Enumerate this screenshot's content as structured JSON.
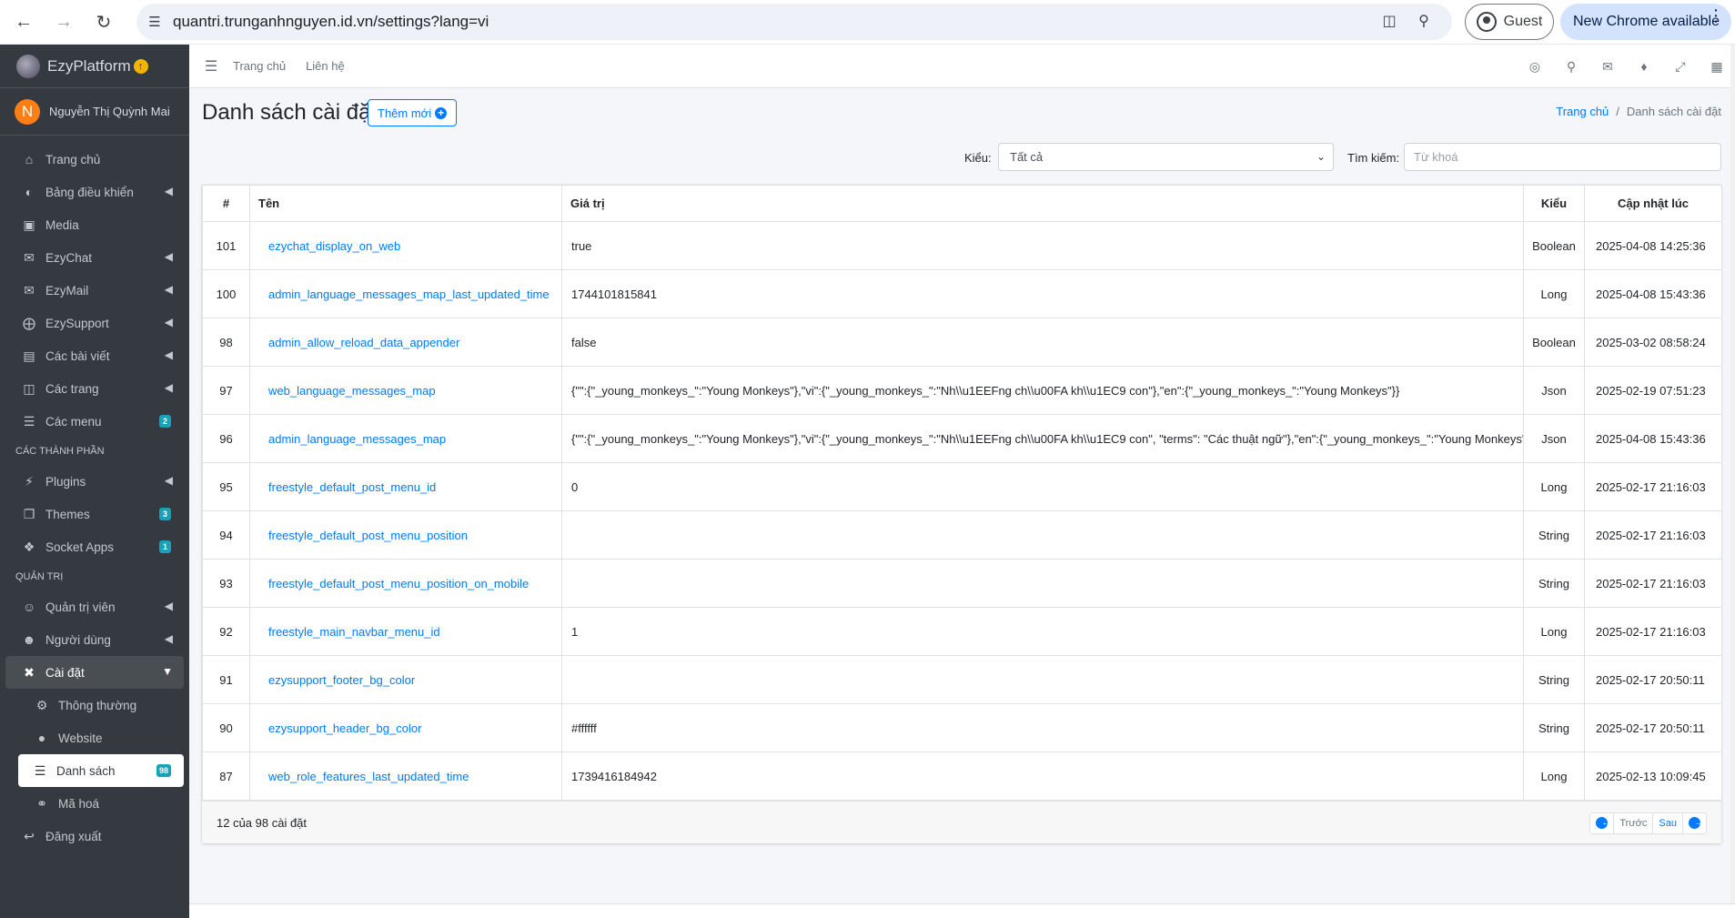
{
  "browser": {
    "url": "quantri.trunganhnguyen.id.vn/settings?lang=vi",
    "guest_label": "Guest",
    "update_label": "New Chrome available"
  },
  "sidebar": {
    "brand": "EzyPlatform",
    "user_initial": "N",
    "user_name": "Nguyễn Thị Quỳnh Mai",
    "items": [
      {
        "label": "Trang chủ",
        "icon": "home-icon"
      },
      {
        "label": "Bảng điều khiển",
        "icon": "dashboard-icon"
      },
      {
        "label": "Media",
        "icon": "image-icon"
      },
      {
        "label": "EzyChat",
        "icon": "chat-icon"
      },
      {
        "label": "EzyMail",
        "icon": "mail-icon"
      },
      {
        "label": "EzySupport",
        "icon": "lifebuoy-icon"
      },
      {
        "label": "Các bài viết",
        "icon": "newspaper-icon"
      },
      {
        "label": "Các trang",
        "icon": "columns-icon"
      },
      {
        "label": "Các menu",
        "icon": "menu-icon",
        "badge": "2"
      }
    ],
    "header_components": "CÁC THÀNH PHẦN",
    "components": [
      {
        "label": "Plugins",
        "icon": "plug-icon"
      },
      {
        "label": "Themes",
        "icon": "copy-icon",
        "badge": "3"
      },
      {
        "label": "Socket Apps",
        "icon": "cubes-icon",
        "badge": "1"
      }
    ],
    "header_admin": "QUẢN TRỊ",
    "admin": [
      {
        "label": "Quản trị viên",
        "icon": "user-circle-icon"
      },
      {
        "label": "Người dùng",
        "icon": "users-icon"
      },
      {
        "label": "Cài đặt",
        "icon": "tools-icon"
      }
    ],
    "settings_sub": [
      {
        "label": "Thông thường",
        "icon": "cogs-icon"
      },
      {
        "label": "Website",
        "icon": "globe-icon"
      },
      {
        "label": "Danh sách",
        "icon": "list-icon",
        "badge": "98"
      },
      {
        "label": "Mã hoá",
        "icon": "key-icon"
      }
    ],
    "logout": "Đăng xuất"
  },
  "topnav": {
    "home": "Trang chủ",
    "contact": "Liên hệ"
  },
  "page": {
    "title": "Danh sách cài đặt",
    "add_button": "Thêm mới",
    "breadcrumb_home": "Trang chủ",
    "breadcrumb_current": "Danh sách cài đặt"
  },
  "filters": {
    "type_label": "Kiểu:",
    "type_value": "Tất cả",
    "search_label": "Tìm kiếm:",
    "search_placeholder": "Từ khoá"
  },
  "table": {
    "headers": [
      "#",
      "Tên",
      "Giá trị",
      "Kiểu",
      "Cập nhật lúc"
    ],
    "rows": [
      {
        "id": "101",
        "name": "ezychat_display_on_web",
        "value": "true",
        "type": "Boolean",
        "updated": "2025-04-08 14:25:36"
      },
      {
        "id": "100",
        "name": "admin_language_messages_map_last_updated_time",
        "value": "1744101815841",
        "type": "Long",
        "updated": "2025-04-08 15:43:36"
      },
      {
        "id": "98",
        "name": "admin_allow_reload_data_appender",
        "value": "false",
        "type": "Boolean",
        "updated": "2025-03-02 08:58:24"
      },
      {
        "id": "97",
        "name": "web_language_messages_map",
        "value": "{\"\":{\"_young_monkeys_\":\"Young Monkeys\"},\"vi\":{\"_young_monkeys_\":\"Nh\\\\u1EEFng ch\\\\u00FA kh\\\\u1EC9 con\"},\"en\":{\"_young_monkeys_\":\"Young Monkeys\"}}",
        "type": "Json",
        "updated": "2025-02-19 07:51:23"
      },
      {
        "id": "96",
        "name": "admin_language_messages_map",
        "value": "{\"\":{\"_young_monkeys_\":\"Young Monkeys\"},\"vi\":{\"_young_monkeys_\":\"Nh\\\\u1EEFng ch\\\\u00FA kh\\\\u1EC9 con\", \"terms\": \"Các thuật ngữ\"},\"en\":{\"_young_monkeys_\":\"Young Monkeys\"}}",
        "type": "Json",
        "updated": "2025-04-08 15:43:36"
      },
      {
        "id": "95",
        "name": "freestyle_default_post_menu_id",
        "value": "0",
        "type": "Long",
        "updated": "2025-02-17 21:16:03"
      },
      {
        "id": "94",
        "name": "freestyle_default_post_menu_position",
        "value": "",
        "type": "String",
        "updated": "2025-02-17 21:16:03"
      },
      {
        "id": "93",
        "name": "freestyle_default_post_menu_position_on_mobile",
        "value": "",
        "type": "String",
        "updated": "2025-02-17 21:16:03"
      },
      {
        "id": "92",
        "name": "freestyle_main_navbar_menu_id",
        "value": "1",
        "type": "Long",
        "updated": "2025-02-17 21:16:03"
      },
      {
        "id": "91",
        "name": "ezysupport_footer_bg_color",
        "value": "",
        "type": "String",
        "updated": "2025-02-17 20:50:11"
      },
      {
        "id": "90",
        "name": "ezysupport_header_bg_color",
        "value": "#ffffff",
        "type": "String",
        "updated": "2025-02-17 20:50:11"
      },
      {
        "id": "87",
        "name": "web_role_features_last_updated_time",
        "value": "1739416184942",
        "type": "Long",
        "updated": "2025-02-13 10:09:45"
      }
    ]
  },
  "footer": {
    "info": "12 của 98 cài đặt",
    "prev": "Trước",
    "next": "Sau"
  },
  "colors": {
    "accent": "#007bff",
    "sidebar_bg": "#343a40",
    "badge": "#17a2b8"
  }
}
